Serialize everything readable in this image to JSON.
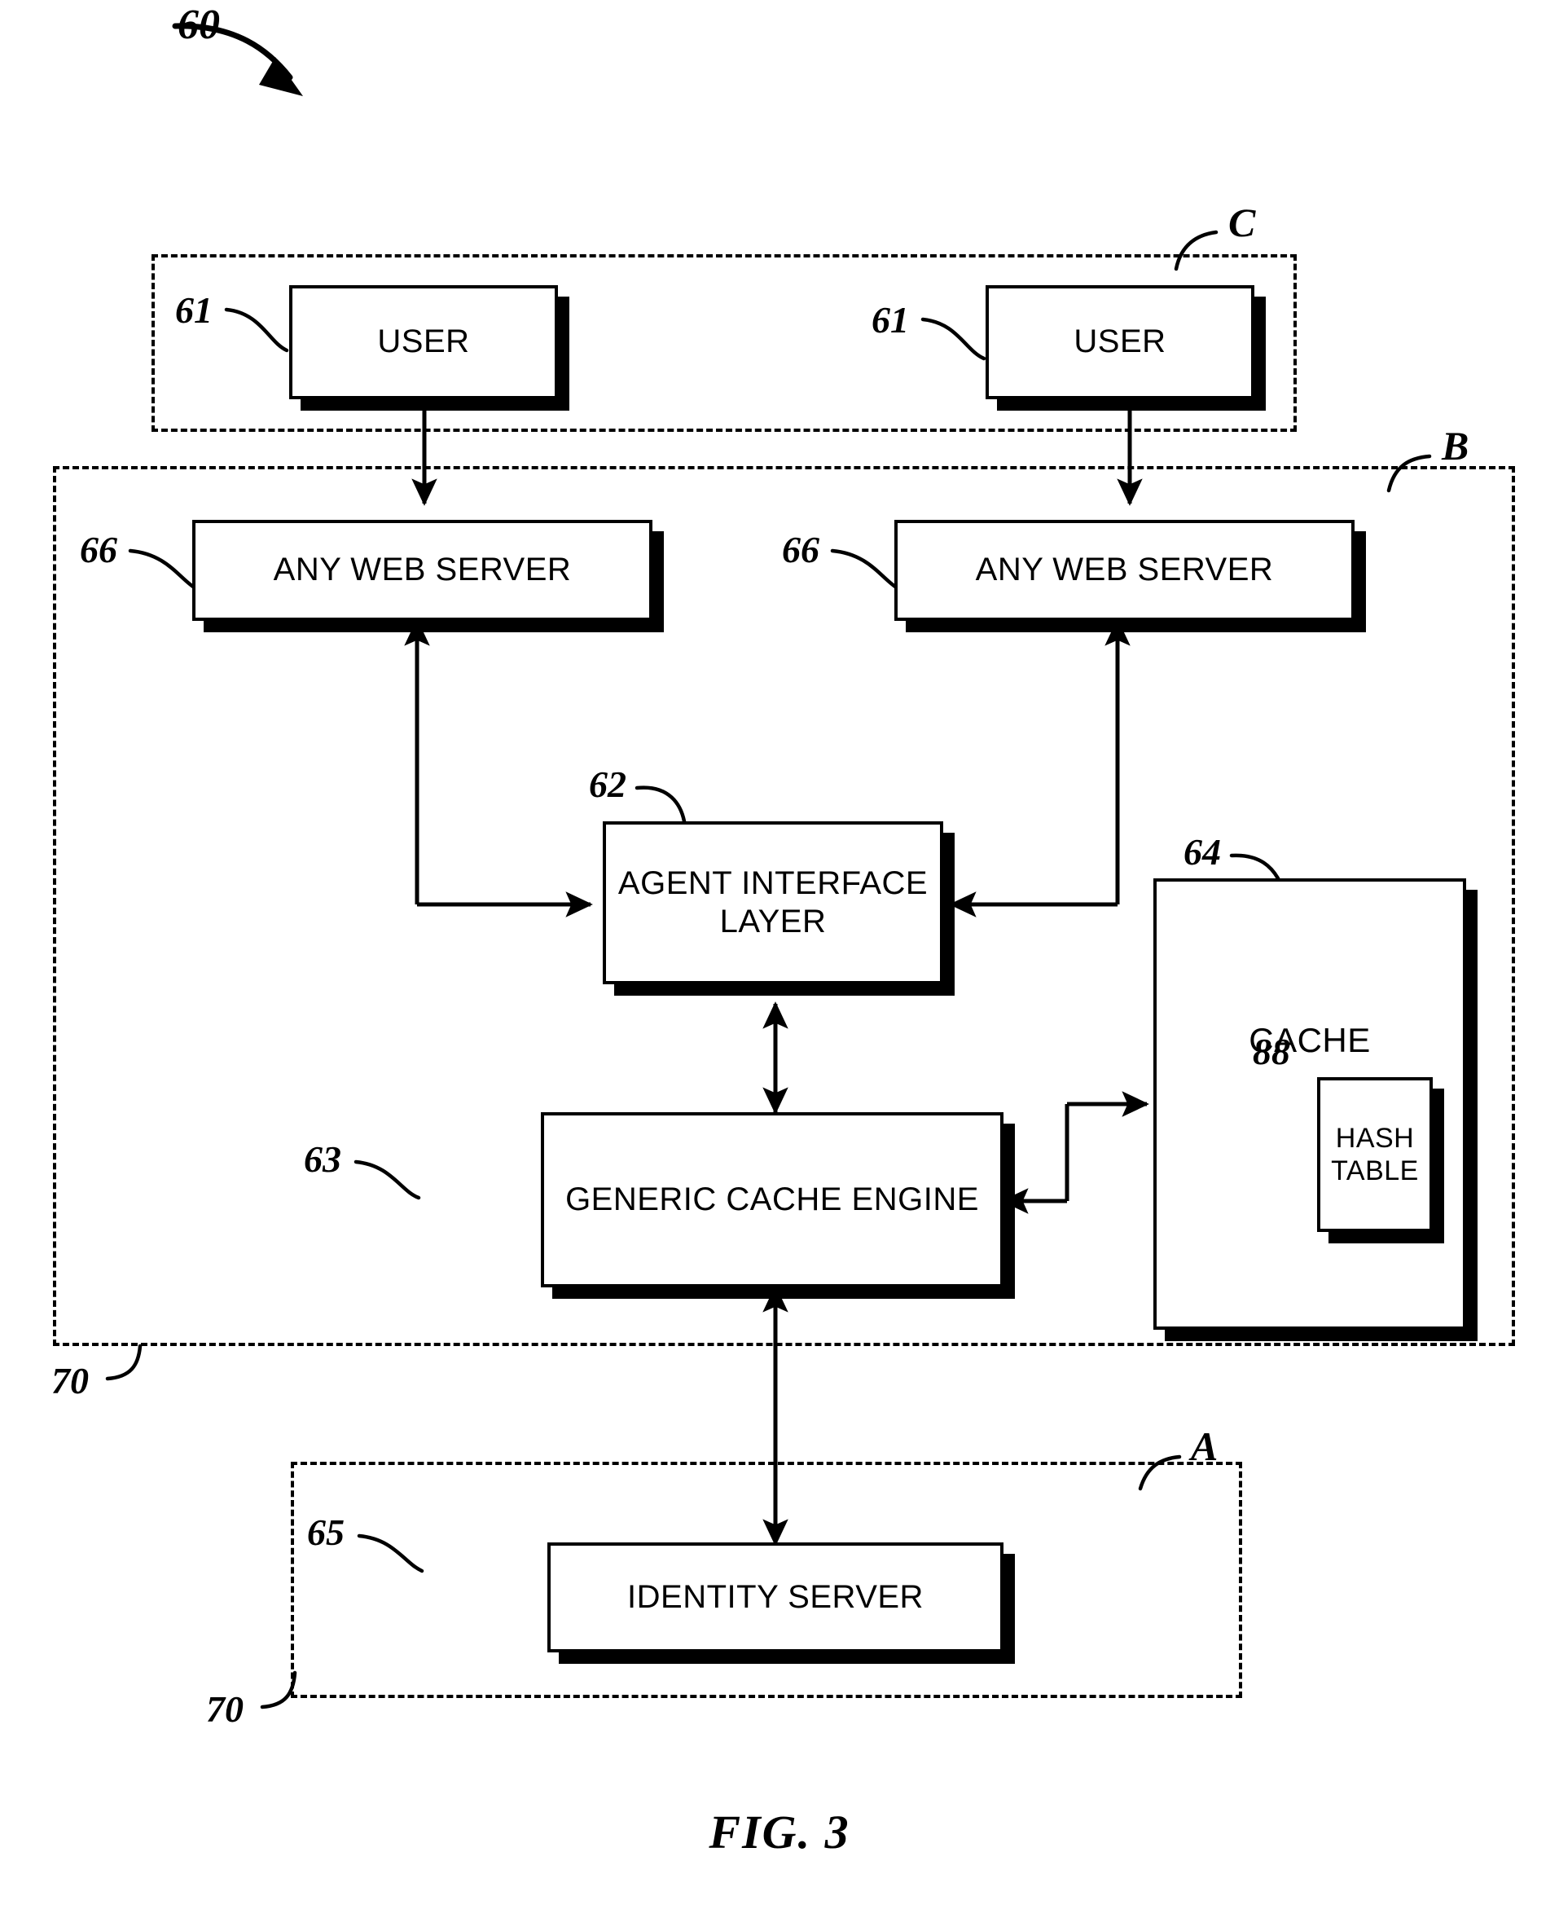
{
  "figure": {
    "caption": "FIG. 3",
    "system_ref": "60"
  },
  "groups": [
    {
      "id": "C",
      "letter": "C",
      "ref": "",
      "name": "client-tier-group"
    },
    {
      "id": "B",
      "letter": "B",
      "ref": "70",
      "name": "middle-tier-group"
    },
    {
      "id": "A",
      "letter": "A",
      "ref": "70",
      "name": "identity-tier-group"
    }
  ],
  "nodes": [
    {
      "key": "user_left",
      "label": "USER",
      "ref": "61"
    },
    {
      "key": "user_right",
      "label": "USER",
      "ref": "61"
    },
    {
      "key": "web_server_left",
      "label": "ANY WEB SERVER",
      "ref": "66"
    },
    {
      "key": "web_server_right",
      "label": "ANY WEB SERVER",
      "ref": "66"
    },
    {
      "key": "agent_interface",
      "label": "AGENT INTERFACE LAYER",
      "ref": "62"
    },
    {
      "key": "cache",
      "label": "CACHE",
      "ref": "64"
    },
    {
      "key": "hash_table",
      "label": "HASH TABLE",
      "ref": "88"
    },
    {
      "key": "cache_engine",
      "label": "GENERIC CACHE ENGINE",
      "ref": "63"
    },
    {
      "key": "identity_server",
      "label": "IDENTITY SERVER",
      "ref": "65"
    }
  ],
  "labels": {
    "user_left": "USER",
    "user_right": "USER",
    "web_server_left": "ANY WEB SERVER",
    "web_server_right": "ANY WEB SERVER",
    "agent_interface_line1": "AGENT INTERFACE",
    "agent_interface_line2": "LAYER",
    "cache": "CACHE",
    "hash_table_line1": "HASH",
    "hash_table_line2": "TABLE",
    "cache_engine": "GENERIC CACHE ENGINE",
    "identity_server": "IDENTITY SERVER"
  },
  "refs": {
    "system": "60",
    "user_left": "61",
    "user_right": "61",
    "web_server_left": "66",
    "web_server_right": "66",
    "agent_interface": "62",
    "cache": "64",
    "hash_table": "88",
    "cache_engine": "63",
    "identity_server": "65",
    "group_c": "C",
    "group_b": "B",
    "group_a": "A",
    "network_b": "70",
    "network_a": "70"
  },
  "colors": {
    "stroke": "#000000",
    "fill": "#ffffff",
    "shadow": "#000000"
  }
}
